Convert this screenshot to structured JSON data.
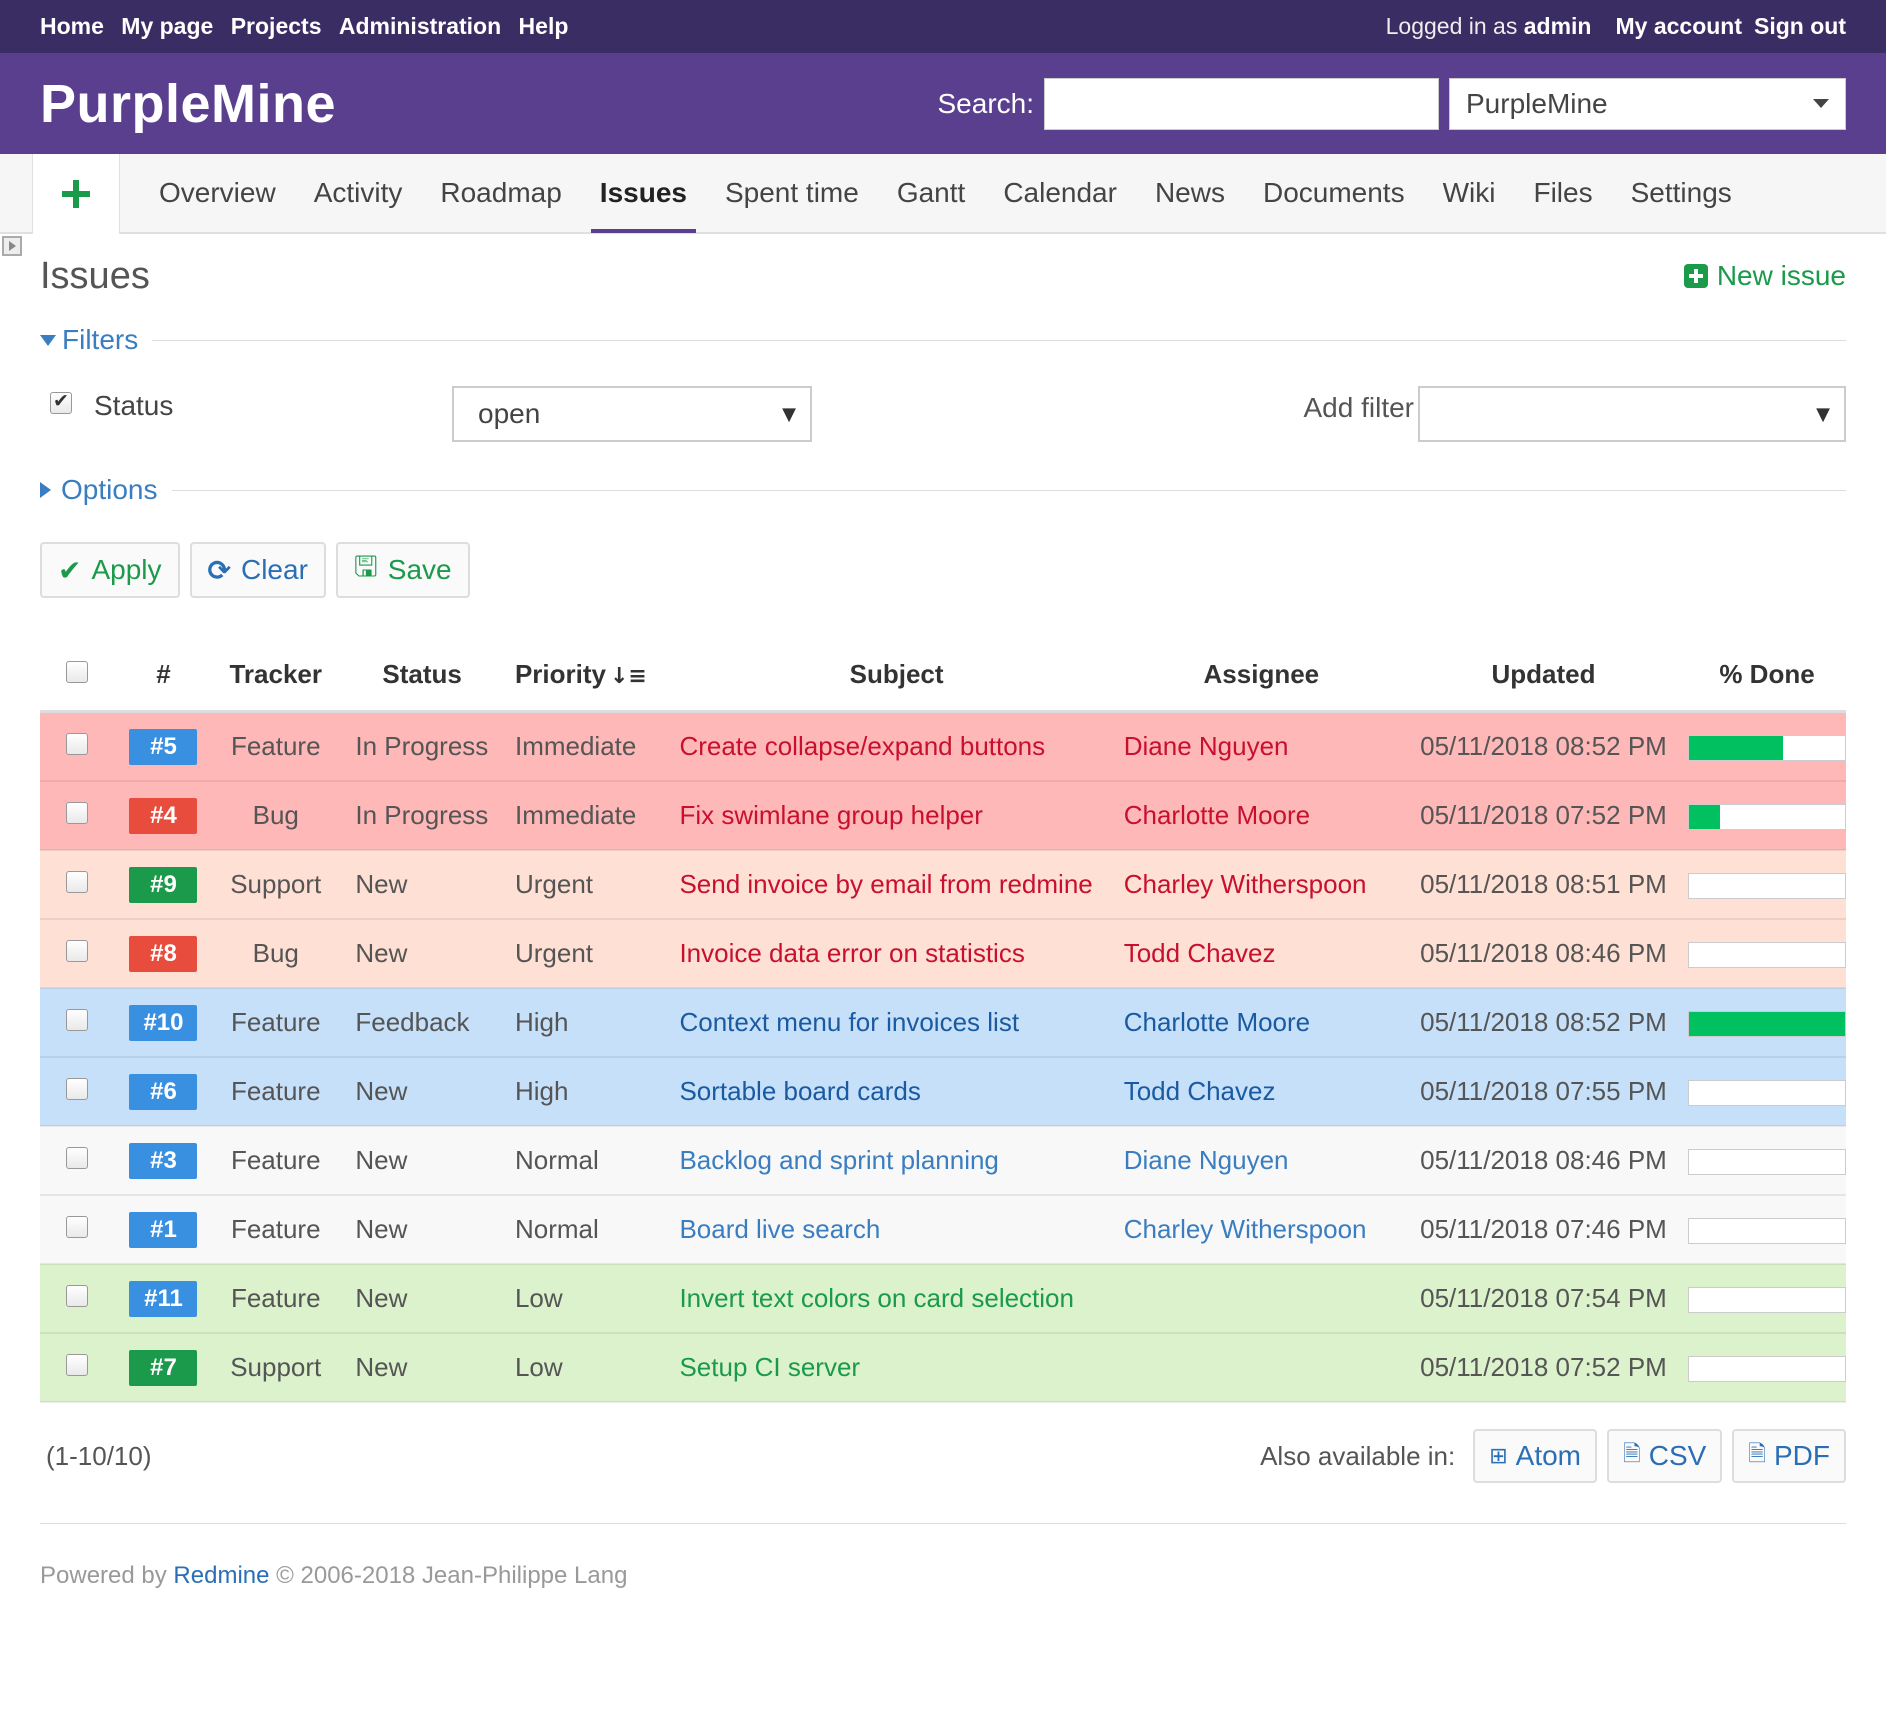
{
  "top_menu": {
    "links": [
      "Home",
      "My page",
      "Projects",
      "Administration",
      "Help"
    ],
    "logged_in_prefix": "Logged in as",
    "user": "admin",
    "account": "My account",
    "signout": "Sign out"
  },
  "header": {
    "title": "PurpleMine",
    "search_label": "Search:",
    "search_value": "",
    "project_select": "PurpleMine"
  },
  "main_menu": {
    "tabs": [
      "Overview",
      "Activity",
      "Roadmap",
      "Issues",
      "Spent time",
      "Gantt",
      "Calendar",
      "News",
      "Documents",
      "Wiki",
      "Files",
      "Settings"
    ],
    "selected": "Issues"
  },
  "page": {
    "title": "Issues",
    "new_issue": "New issue"
  },
  "filters": {
    "legend": "Filters",
    "status_label": "Status",
    "status_checked": true,
    "status_value": "open",
    "add_filter_label": "Add filter",
    "add_filter_value": "",
    "options_legend": "Options"
  },
  "buttons": {
    "apply": "Apply",
    "clear": "Clear",
    "save": "Save"
  },
  "table": {
    "columns": [
      "#",
      "Tracker",
      "Status",
      "Priority",
      "Subject",
      "Assignee",
      "Updated",
      "% Done"
    ],
    "rows": [
      {
        "id": "#5",
        "tracker": "Feature",
        "status": "In Progress",
        "priority": "Immediate",
        "subject": "Create collapse/expand buttons",
        "assignee": "Diane Nguyen",
        "updated": "05/11/2018 08:52 PM",
        "done": 60
      },
      {
        "id": "#4",
        "tracker": "Bug",
        "status": "In Progress",
        "priority": "Immediate",
        "subject": "Fix swimlane group helper",
        "assignee": "Charlotte Moore",
        "updated": "05/11/2018 07:52 PM",
        "done": 20
      },
      {
        "id": "#9",
        "tracker": "Support",
        "status": "New",
        "priority": "Urgent",
        "subject": "Send invoice by email from redmine",
        "assignee": "Charley Witherspoon",
        "updated": "05/11/2018 08:51 PM",
        "done": 0
      },
      {
        "id": "#8",
        "tracker": "Bug",
        "status": "New",
        "priority": "Urgent",
        "subject": "Invoice data error on statistics",
        "assignee": "Todd Chavez",
        "updated": "05/11/2018 08:46 PM",
        "done": 0
      },
      {
        "id": "#10",
        "tracker": "Feature",
        "status": "Feedback",
        "priority": "High",
        "subject": "Context menu for invoices list",
        "assignee": "Charlotte Moore",
        "updated": "05/11/2018 08:52 PM",
        "done": 100
      },
      {
        "id": "#6",
        "tracker": "Feature",
        "status": "New",
        "priority": "High",
        "subject": "Sortable board cards",
        "assignee": "Todd Chavez",
        "updated": "05/11/2018 07:55 PM",
        "done": 0
      },
      {
        "id": "#3",
        "tracker": "Feature",
        "status": "New",
        "priority": "Normal",
        "subject": "Backlog and sprint planning",
        "assignee": "Diane Nguyen",
        "updated": "05/11/2018 08:46 PM",
        "done": 0
      },
      {
        "id": "#1",
        "tracker": "Feature",
        "status": "New",
        "priority": "Normal",
        "subject": "Board live search",
        "assignee": "Charley Witherspoon",
        "updated": "05/11/2018 07:46 PM",
        "done": 0
      },
      {
        "id": "#11",
        "tracker": "Feature",
        "status": "New",
        "priority": "Low",
        "subject": "Invert text colors on card selection",
        "assignee": "",
        "updated": "05/11/2018 07:54 PM",
        "done": 0
      },
      {
        "id": "#7",
        "tracker": "Support",
        "status": "New",
        "priority": "Low",
        "subject": "Setup CI server",
        "assignee": "",
        "updated": "05/11/2018 07:52 PM",
        "done": 0
      }
    ]
  },
  "colors": {
    "priority_bg": {
      "Immediate": "#ffb8b8",
      "Urgent": "#ffe0d4",
      "High": "#c6e0fa",
      "Normal": "#f8f8f8",
      "Low": "#dcf2cc"
    },
    "priority_text": {
      "Immediate": "#c8102e",
      "Urgent": "#c8102e",
      "High": "#1a5aa0",
      "Normal": "#3a7dc0",
      "Low": "#1a9a4a"
    },
    "tracker_badge": {
      "Feature": "#3a90e0",
      "Bug": "#e84c3d",
      "Support": "#1a9a4a"
    }
  },
  "pagination": "(1-10/10)",
  "formats": {
    "label": "Also available in:",
    "items": [
      "Atom",
      "CSV",
      "PDF"
    ]
  },
  "footer": {
    "prefix": "Powered by",
    "link": "Redmine",
    "suffix": "© 2006-2018 Jean-Philippe Lang"
  }
}
